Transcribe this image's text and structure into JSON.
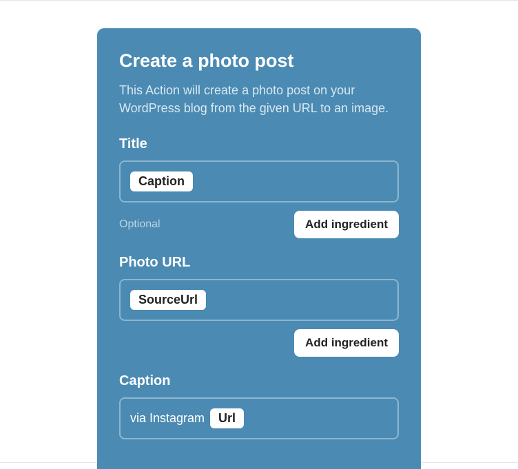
{
  "card": {
    "title": "Create a photo post",
    "description": "This Action will create a photo post on your WordPress blog from the given URL to an image."
  },
  "fields": {
    "title": {
      "label": "Title",
      "pill": "Caption",
      "optional": "Optional",
      "addButton": "Add ingredient"
    },
    "photoUrl": {
      "label": "Photo URL",
      "pill": "SourceUrl",
      "addButton": "Add ingredient"
    },
    "caption": {
      "label": "Caption",
      "prefix": "via Instagram",
      "pill": "Url"
    }
  }
}
